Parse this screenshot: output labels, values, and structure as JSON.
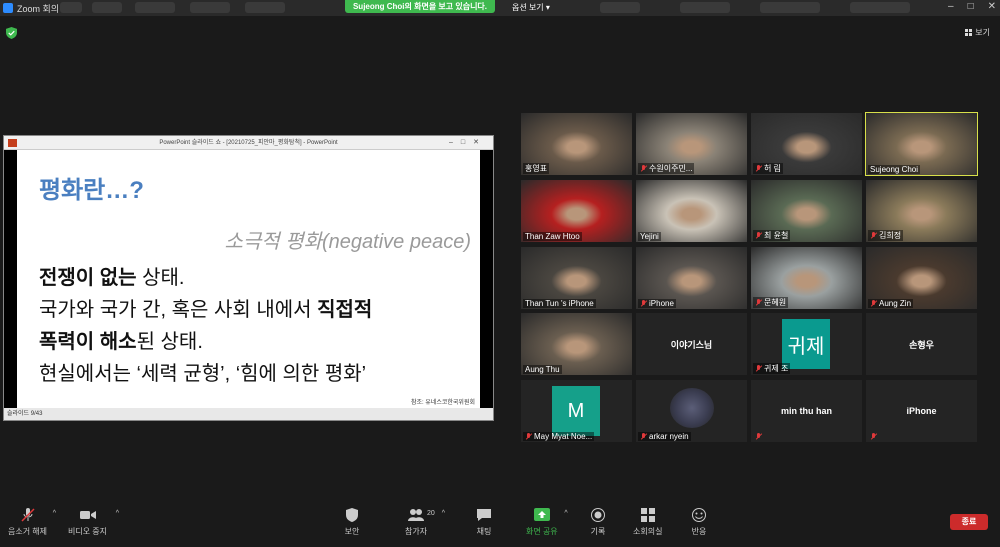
{
  "titlebar": {
    "app_title": "Zoom 회의",
    "share_banner": "Sujeong Choi의 화면을 보고 있습니다.",
    "view_options": "옵션 보기"
  },
  "top_right": {
    "view_label": "보기"
  },
  "powerpoint": {
    "window_title": "PowerPoint 슬라이드 쇼 - [20210725_피안마_평화탐척] - PowerPoint",
    "slide_title": "평화란…?",
    "slide_subtitle": "소극적 평화(negative peace)",
    "line1_bold": "전쟁이 없는",
    "line1_rest": " 상태.",
    "line2_prefix": "국가와 국가 간, 혹은 사회 내에서 ",
    "line2_bold": "직접적",
    "line3_bold": "폭력이 해소",
    "line3_rest": "된 상태.",
    "line4": "현실에서는 ‘세력 균형’, ‘힘에 의한 평화’",
    "reference": "참조: 유네스코한국위원회",
    "status": "슬라이드 9/43"
  },
  "participants": [
    {
      "name": "홍영표",
      "muted": false,
      "type": "video",
      "color": "#6a5a4a"
    },
    {
      "name": "수원이주민...",
      "muted": true,
      "type": "video",
      "color": "#8a8276"
    },
    {
      "name": "허 림",
      "muted": true,
      "type": "video",
      "color": "#3a3a3a"
    },
    {
      "name": "Sujeong Choi",
      "muted": false,
      "type": "video",
      "color": "#7a6a52",
      "active": true
    },
    {
      "name": "Than Zaw Htoo",
      "muted": false,
      "type": "video",
      "color": "#b52020"
    },
    {
      "name": "Yejini",
      "muted": false,
      "type": "video",
      "color": "#c9c2b6"
    },
    {
      "name": "최 윤철",
      "muted": true,
      "type": "video",
      "color": "#5a6a54"
    },
    {
      "name": "김희정",
      "muted": true,
      "type": "video",
      "color": "#8a7a5a"
    },
    {
      "name": "Than Tun 's iPhone",
      "muted": false,
      "type": "video",
      "color": "#4a4640"
    },
    {
      "name": "iPhone",
      "muted": true,
      "type": "video",
      "color": "#5a5550"
    },
    {
      "name": "문혜원",
      "muted": true,
      "type": "video",
      "color": "#9aa0a0"
    },
    {
      "name": "Aung Zin",
      "muted": true,
      "type": "video",
      "color": "#4a3a2e"
    },
    {
      "name": "Aung Thu",
      "muted": false,
      "type": "video",
      "color": "#6a5e50"
    },
    {
      "name": "이야기스님",
      "muted": false,
      "type": "name"
    },
    {
      "name": "귀제 조",
      "muted": true,
      "type": "avatar",
      "avatar_text": "귀제",
      "avatar_color": "#0a9a8f"
    },
    {
      "name": "손형우",
      "muted": false,
      "type": "name"
    },
    {
      "name": "May Myat Noe...",
      "muted": true,
      "type": "avatar",
      "avatar_text": "M",
      "avatar_color": "#15a08a"
    },
    {
      "name": "arkar nyein",
      "muted": true,
      "type": "heart"
    },
    {
      "name": "min thu han",
      "muted": true,
      "type": "name"
    },
    {
      "name": "iPhone",
      "muted": true,
      "type": "name"
    }
  ],
  "toolbar": {
    "unmute": "음소거 해제",
    "stop_video": "비디오 중지",
    "security": "보안",
    "participants": "참가자",
    "participants_count": "20",
    "chat": "채팅",
    "share_screen": "화면 공유",
    "record": "기록",
    "breakout": "소회의실",
    "reactions": "반응",
    "end": "종료"
  }
}
